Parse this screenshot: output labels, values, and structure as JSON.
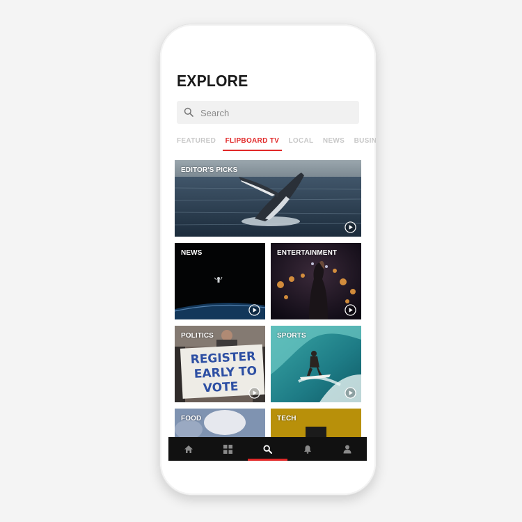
{
  "page": {
    "title": "EXPLORE"
  },
  "search": {
    "placeholder": "Search",
    "icon": "search-icon"
  },
  "tabs": [
    {
      "label": "FEATURED",
      "active": false
    },
    {
      "label": "FLIPBOARD TV",
      "active": true
    },
    {
      "label": "LOCAL",
      "active": false
    },
    {
      "label": "NEWS",
      "active": false
    },
    {
      "label": "BUSINESS",
      "active": false
    }
  ],
  "tiles": {
    "editors_picks": {
      "label": "EDITOR'S PICKS"
    },
    "news": {
      "label": "NEWS"
    },
    "entertainment": {
      "label": "ENTERTAINMENT"
    },
    "politics": {
      "label": "POLITICS",
      "sign_lines": [
        "REGISTER",
        "EARLY TO",
        "VOTE"
      ]
    },
    "sports": {
      "label": "SPORTS"
    },
    "food": {
      "label": "FOOD"
    },
    "tech": {
      "label": "TECH"
    }
  },
  "bottom_nav": [
    {
      "icon": "home-icon",
      "active": false
    },
    {
      "icon": "grid-icon",
      "active": false
    },
    {
      "icon": "search-icon",
      "active": true
    },
    {
      "icon": "bell-icon",
      "active": false
    },
    {
      "icon": "profile-icon",
      "active": false
    }
  ],
  "colors": {
    "accent": "#e12828",
    "background": "#f4f4f4",
    "nav_bar": "#111111"
  }
}
